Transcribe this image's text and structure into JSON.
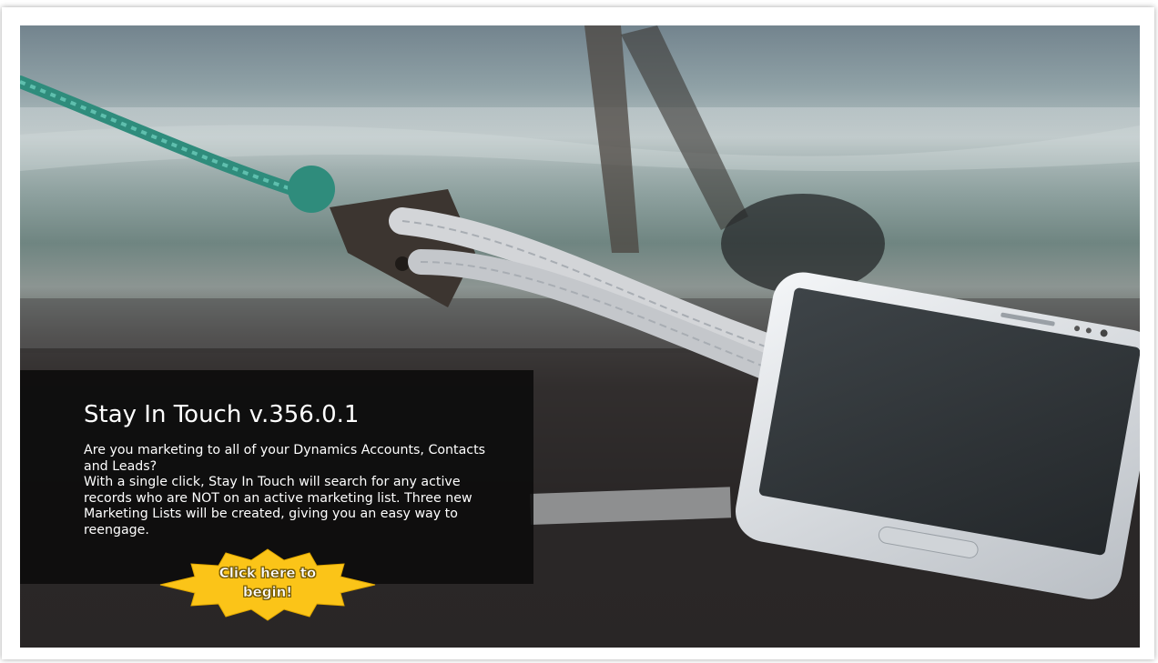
{
  "slide": {
    "title": "Stay In Touch v.356.0.1",
    "description": "Are you marketing to all of your Dynamics Accounts, Contacts and Leads?\nWith a single click, Stay In Touch will search for any active records who are NOT on an active marketing list.  Three new Marketing Lists will be created, giving you an easy way to reengage.",
    "cta_label": "Click here to\nbegin!"
  },
  "colors": {
    "panel_background": "#0c0c0c",
    "cta_fill": "#fbc418",
    "cta_text": "#ffffff"
  },
  "icons": {
    "cta_shape": "starburst-icon",
    "photo": "rope-and-smartphone-photo"
  }
}
